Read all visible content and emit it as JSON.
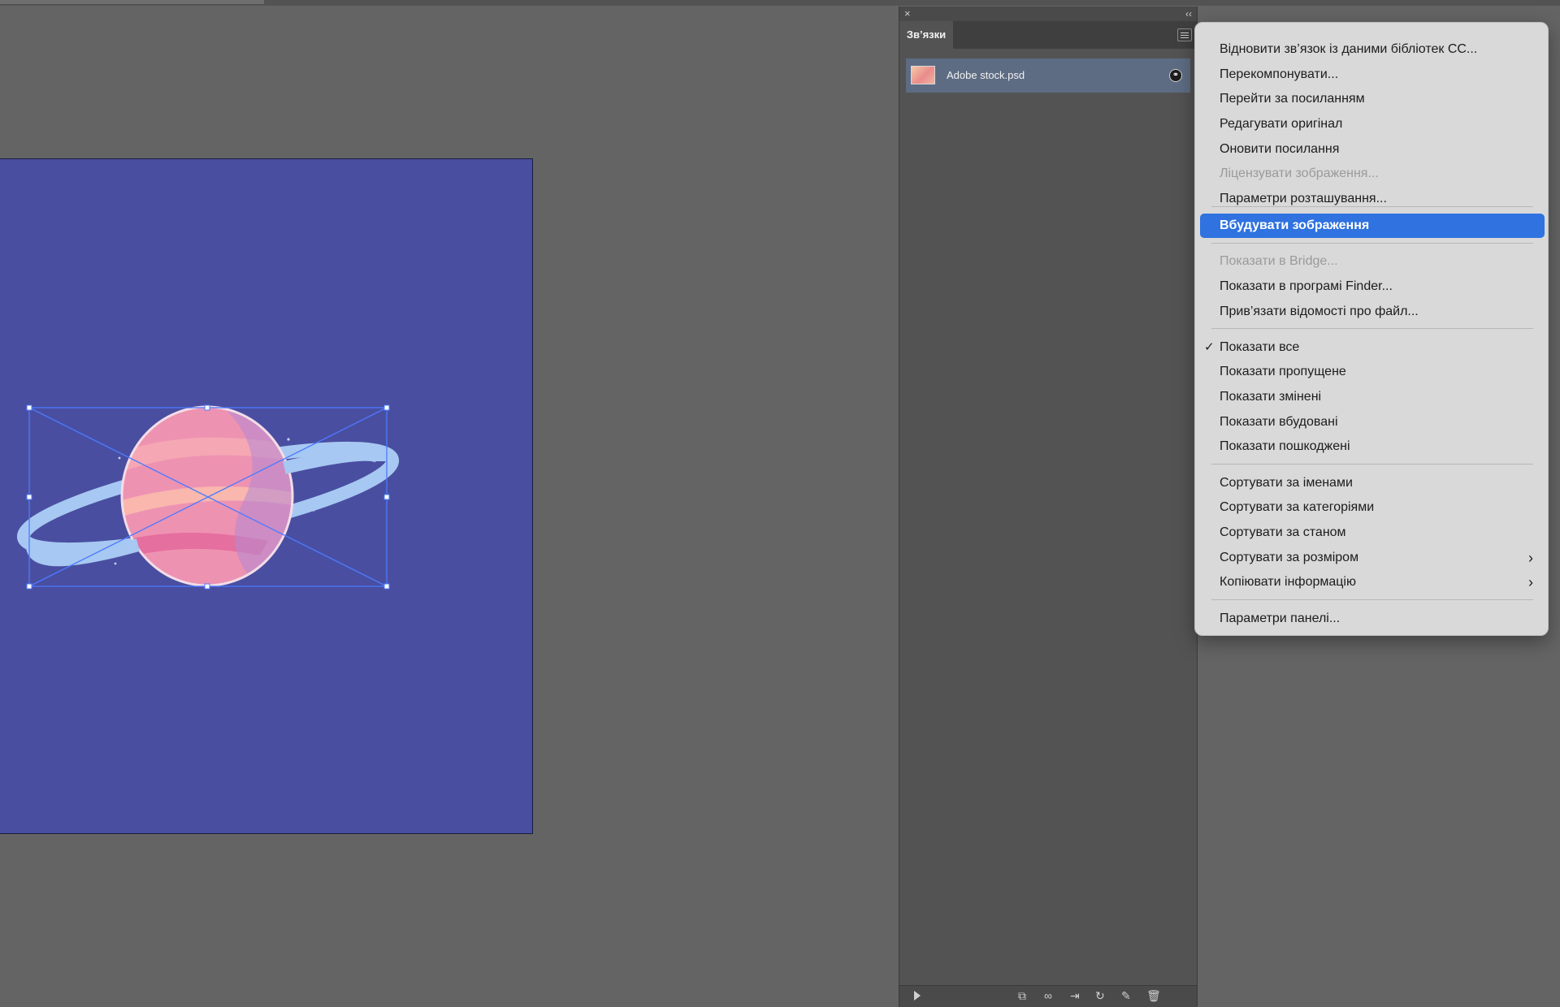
{
  "panel": {
    "tab_label": "Зв’язки",
    "close_glyph": "×",
    "collapse_glyph": "‹‹",
    "link_item": {
      "file_name": "Adobe stock.psd",
      "status_icon": "link-icon",
      "badge_glyph": "⚭"
    }
  },
  "footer": {
    "icons": [
      "relink-cc-icon",
      "relink-icon",
      "go-to-link-icon",
      "update-link-icon",
      "edit-original-icon",
      "delete-icon"
    ],
    "glyphs": [
      "⧉",
      "∞",
      "⇥",
      "↻",
      "✎",
      "🗑"
    ]
  },
  "menu": {
    "highlight_color": "#2f72e0",
    "items": [
      {
        "label": "Відновити зв’язок із даними бібліотек CC...",
        "disabled": false
      },
      {
        "label": "Перекомпонувати...",
        "disabled": false
      },
      {
        "label": "Перейти за посиланням",
        "disabled": false
      },
      {
        "label": "Редагувати оригінал",
        "disabled": false
      },
      {
        "label": "Оновити посилання",
        "disabled": false
      },
      {
        "label": "Ліцензувати зображення...",
        "disabled": true
      },
      {
        "label": "Параметри розташування...",
        "disabled": false
      },
      {
        "label": "Вбудувати зображення",
        "highlighted": true
      },
      {
        "label": "Показати в Bridge...",
        "disabled": true
      },
      {
        "label": "Показати в програмі Finder...",
        "disabled": false
      },
      {
        "label": "Прив’язати відомості про файл...",
        "disabled": false
      },
      {
        "label": "Показати все",
        "checked": true,
        "check_glyph": "✓"
      },
      {
        "label": "Показати пропущене",
        "disabled": false
      },
      {
        "label": "Показати змінені",
        "disabled": false
      },
      {
        "label": "Показати вбудовані",
        "disabled": false
      },
      {
        "label": "Показати пошкоджені",
        "disabled": false
      },
      {
        "label": "Сортувати за іменами",
        "disabled": false
      },
      {
        "label": "Сортувати за категоріями",
        "disabled": false
      },
      {
        "label": "Сортувати за станом",
        "disabled": false
      },
      {
        "label": "Сортувати за розміром",
        "submenu": true,
        "arrow_glyph": "›"
      },
      {
        "label": "Копіювати інформацію",
        "submenu": true,
        "arrow_glyph": "›"
      },
      {
        "label": "Параметри панелі...",
        "disabled": false
      }
    ]
  },
  "artboard": {
    "background_color": "#4a4ea0",
    "selection_color": "#4a7bff"
  }
}
